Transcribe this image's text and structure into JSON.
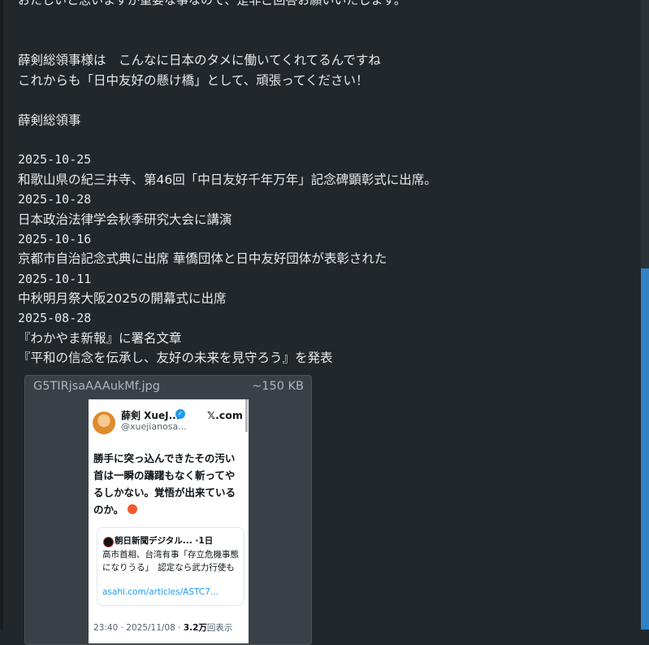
{
  "post": {
    "cut_line": "おたしいと思いますが重要な事なので、是非ご回答お願いいたします。",
    "lines": [
      "薛剣総領事様は　こんなに日本のタメに働いてくれてるんですね",
      "これからも「日中友好の懸け橋」として、頑張ってください！",
      "薛剣総領事",
      "2025-10-25",
      "和歌山県の紀三井寺、第46回「中日友好千年万年」記念碑顕彰式に出席。",
      "2025-10-28",
      "日本政治法律学会秋季研究大会に講演",
      "2025-10-16",
      "京都市自治記念式典に出席 華僑団体と日中友好団体が表彰された",
      "2025-10-11",
      "中秋明月祭大阪2025の開幕式に出席",
      "2025-08-28",
      "『わかやま新報』に署名文章",
      "『平和の信念を伝承し、友好の未来を見守ろう』を発表"
    ]
  },
  "attachment": {
    "filename": "G5TIRjsaAAAukMf.jpg",
    "size": "~150 KB",
    "tweet": {
      "display_name": "薛剣 XueJ...",
      "handle": "@xuejianosa...",
      "site": "𝕏.com",
      "body": "勝手に突っ込んできたその汚い首は一瞬の躊躇もなく斬ってやるしかない。覚悟が出来ているのか。",
      "quote_header": "朝日新聞デジタル... ·1日",
      "quote_text": "高市首相、台湾有事「存立危機事態になりうる」　認定なら武力行使も",
      "quote_link": "asahi.com/articles/ASTC7...",
      "footer_time": "23:40 · 2025/11/08 · ",
      "footer_views": "3.2万",
      "footer_suffix": "回表示"
    }
  },
  "colors": {
    "background": "#22272b",
    "scrollbar_thumb": "#2f83c6",
    "link": "#1d9bf0"
  }
}
